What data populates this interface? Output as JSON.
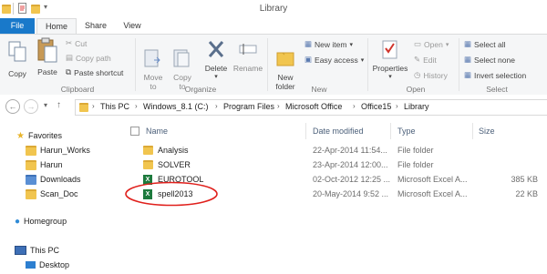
{
  "window": {
    "title": "Library"
  },
  "tabs": [
    {
      "label": "File"
    },
    {
      "label": "Home"
    },
    {
      "label": "Share"
    },
    {
      "label": "View"
    }
  ],
  "ribbon": {
    "clipboard": {
      "copy": "Copy",
      "paste": "Paste",
      "cut": "Cut",
      "copy_path": "Copy path",
      "paste_shortcut": "Paste shortcut",
      "group": "Clipboard"
    },
    "organize": {
      "move_to": "Move\nto",
      "copy_to": "Copy\nto",
      "delete": "Delete",
      "rename": "Rename",
      "group": "Organize"
    },
    "new": {
      "new_folder": "New\nfolder",
      "new_item": "New item",
      "easy_access": "Easy access",
      "group": "New"
    },
    "open": {
      "properties": "Properties",
      "open": "Open",
      "edit": "Edit",
      "history": "History",
      "group": "Open"
    },
    "select": {
      "select_all": "Select all",
      "select_none": "Select none",
      "invert": "Invert selection",
      "group": "Select"
    }
  },
  "address": {
    "crumbs": [
      "This PC",
      "Windows_8.1 (C:)",
      "Program Files",
      "Microsoft Office",
      "Office15",
      "Library"
    ]
  },
  "navpane": {
    "favorites": "Favorites",
    "fav_items": [
      "Harun_Works",
      "Harun",
      "Downloads",
      "Scan_Doc"
    ],
    "homegroup": "Homegroup",
    "thispc": "This PC",
    "desktop": "Desktop"
  },
  "columns": {
    "name": "Name",
    "date": "Date modified",
    "type": "Type",
    "size": "Size"
  },
  "files": [
    {
      "name": "Analysis",
      "date": "22-Apr-2014 11:54...",
      "type": "File folder",
      "size": "",
      "kind": "folder"
    },
    {
      "name": "SOLVER",
      "date": "23-Apr-2014 12:00...",
      "type": "File folder",
      "size": "",
      "kind": "folder"
    },
    {
      "name": "EUROTOOL",
      "date": "02-Oct-2012 12:25 ...",
      "type": "Microsoft Excel A...",
      "size": "385 KB",
      "kind": "excel"
    },
    {
      "name": "spell2013",
      "date": "20-May-2014 9:52 ...",
      "type": "Microsoft Excel A...",
      "size": "22 KB",
      "kind": "excel"
    }
  ],
  "colors": {
    "file_tab": "#1979ca",
    "annotation": "#e0201c"
  }
}
